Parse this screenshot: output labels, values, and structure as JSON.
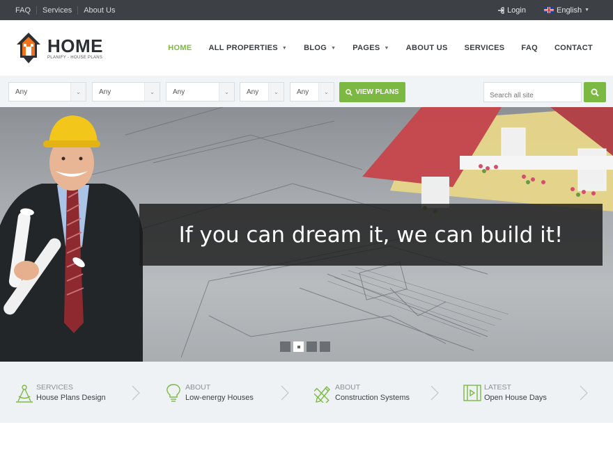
{
  "topbar": {
    "links": [
      "FAQ",
      "Services",
      "About Us"
    ],
    "login": "Login",
    "language": "English"
  },
  "logo": {
    "title": "HOME",
    "tagline": "PLANIFY - HOUSE PLANS"
  },
  "nav": [
    {
      "label": "HOME",
      "active": true,
      "caret": false
    },
    {
      "label": "ALL PROPERTIES",
      "active": false,
      "caret": true
    },
    {
      "label": "BLOG",
      "active": false,
      "caret": true
    },
    {
      "label": "PAGES",
      "active": false,
      "caret": true
    },
    {
      "label": "ABOUT US",
      "active": false,
      "caret": false
    },
    {
      "label": "SERVICES",
      "active": false,
      "caret": false
    },
    {
      "label": "FAQ",
      "active": false,
      "caret": false
    },
    {
      "label": "CONTACT",
      "active": false,
      "caret": false
    }
  ],
  "search": {
    "selects": [
      "Any",
      "Any",
      "Any",
      "Any",
      "Any"
    ],
    "view_plans": "VIEW PLANS",
    "placeholder": "Search all site"
  },
  "hero": {
    "caption": "If you can dream it, we can build it!",
    "slides": 4,
    "active_slide": 2
  },
  "features": [
    {
      "kicker": "SERVICES",
      "title": "House Plans Design",
      "icon": "compass-icon"
    },
    {
      "kicker": "ABOUT",
      "title": "Low-energy Houses",
      "icon": "lightbulb-icon"
    },
    {
      "kicker": "ABOUT",
      "title": "Construction Systems",
      "icon": "pencil-ruler-icon"
    },
    {
      "kicker": "LATEST",
      "title": "Open House Days",
      "icon": "video-icon"
    }
  ],
  "colors": {
    "accent": "#7cb943",
    "topbar": "#3d4045",
    "strip": "#eff2f4"
  }
}
